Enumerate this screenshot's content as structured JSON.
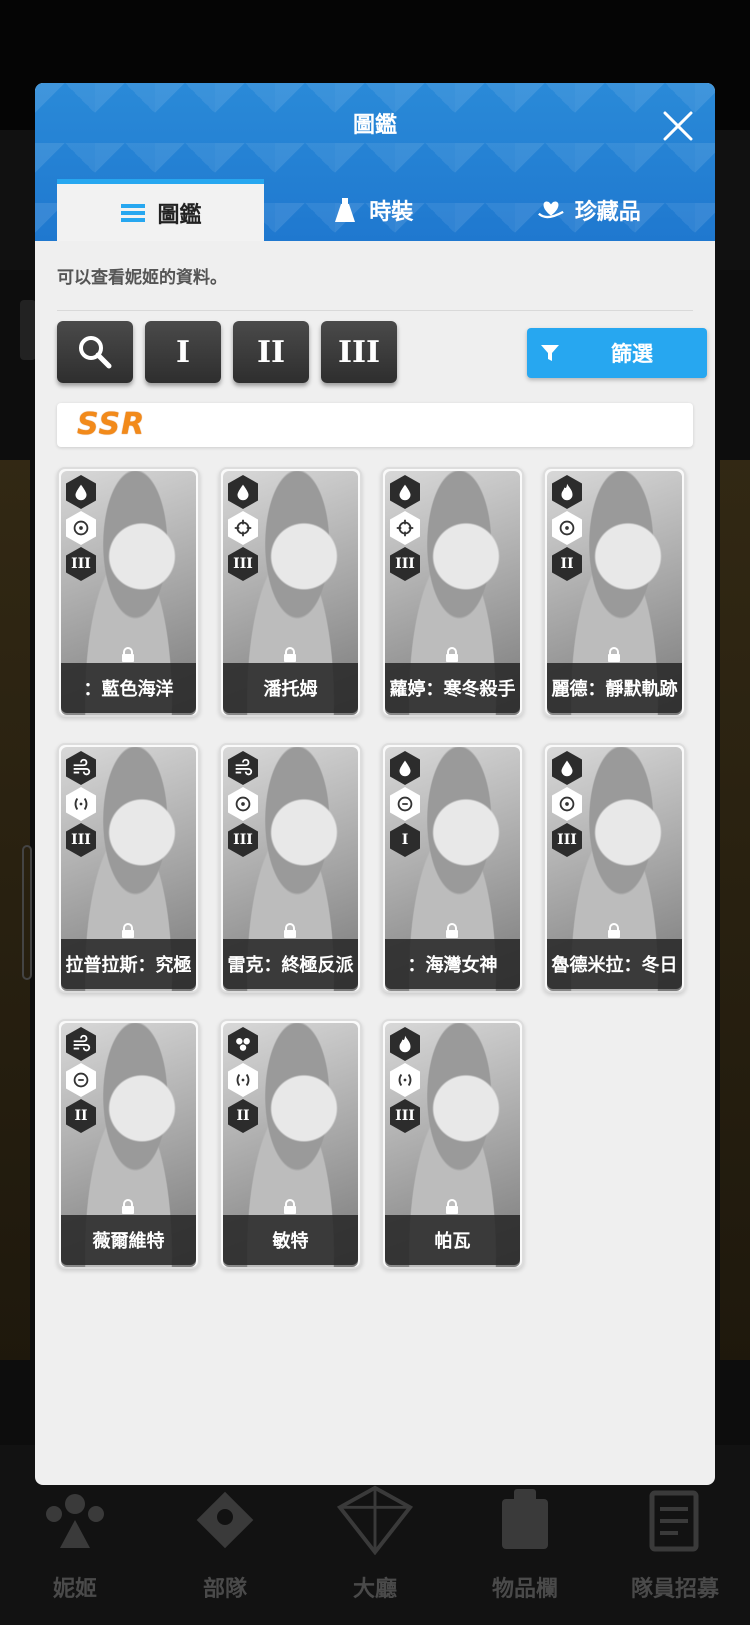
{
  "dialog": {
    "title": "圖鑑",
    "tabs": [
      {
        "label": "圖鑑",
        "icon": "list-icon",
        "active": true
      },
      {
        "label": "時裝",
        "icon": "dress-icon",
        "active": false
      },
      {
        "label": "珍藏品",
        "icon": "heart-hand-icon",
        "active": false
      }
    ],
    "description": "可以查看妮姬的資料。",
    "filters": {
      "search_icon": "search-icon",
      "burst_1": "I",
      "burst_2": "II",
      "burst_3": "III",
      "sift_label": "篩選"
    },
    "rarity_header": "SSR"
  },
  "cards": [
    {
      "name": "：藍色海洋",
      "element": "water-icon",
      "weapon": "target-icon",
      "burst": "III"
    },
    {
      "name": "潘托姆",
      "element": "water-icon",
      "weapon": "crosshair-icon",
      "burst": "III"
    },
    {
      "name": "蘿婷：寒冬殺手",
      "element": "water-icon",
      "weapon": "crosshair-icon",
      "burst": "III"
    },
    {
      "name": "麗德：靜默軌跡",
      "element": "fire-icon",
      "weapon": "target-icon",
      "burst": "II"
    },
    {
      "name": "拉普拉斯：究極",
      "element": "wind-icon",
      "weapon": "bracket-icon",
      "burst": "III"
    },
    {
      "name": "雷克：終極反派",
      "element": "wind-icon",
      "weapon": "target-icon",
      "burst": "III"
    },
    {
      "name": "：海灣女神",
      "element": "water-icon",
      "weapon": "ring-icon",
      "burst": "I"
    },
    {
      "name": "魯德米拉：冬日",
      "element": "water-icon",
      "weapon": "target-icon",
      "burst": "III"
    },
    {
      "name": "薇爾維特",
      "element": "wind-icon",
      "weapon": "ring-icon",
      "burst": "II"
    },
    {
      "name": "敏特",
      "element": "iron-icon",
      "weapon": "bracket-icon",
      "burst": "II"
    },
    {
      "name": "帕瓦",
      "element": "fire-icon",
      "weapon": "bracket-icon",
      "burst": "III"
    }
  ],
  "bottom_nav": [
    {
      "label": "妮姬",
      "icon": "nikke-icon"
    },
    {
      "label": "部隊",
      "icon": "squad-icon"
    },
    {
      "label": "大廳",
      "icon": "lobby-icon"
    },
    {
      "label": "物品欄",
      "icon": "inventory-icon"
    },
    {
      "label": "隊員招募",
      "icon": "recruit-icon"
    }
  ]
}
